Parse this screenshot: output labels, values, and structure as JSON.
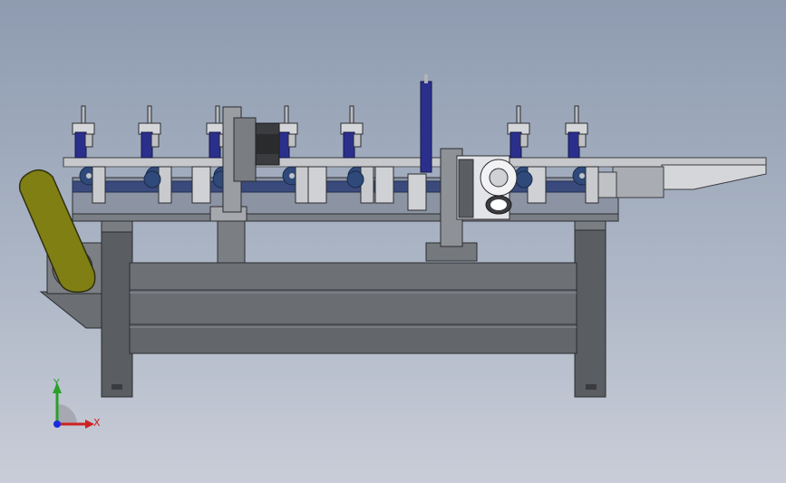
{
  "triad": {
    "y_label": "Y",
    "x_label": "X",
    "colors": {
      "y": "#2aa02a",
      "x": "#d02020",
      "z": "#1a2adf"
    }
  },
  "colors": {
    "background_top": "#8e9bb0",
    "background_bottom": "#c9cdd8",
    "frame": "#5d6064",
    "frame_light": "#8a8d92",
    "beam": "#6d7176",
    "blue_roller": "#2f4a7a",
    "cylinder": "#2b2f8c",
    "belt": "#7f7f14",
    "plate": "#d9dadd"
  }
}
